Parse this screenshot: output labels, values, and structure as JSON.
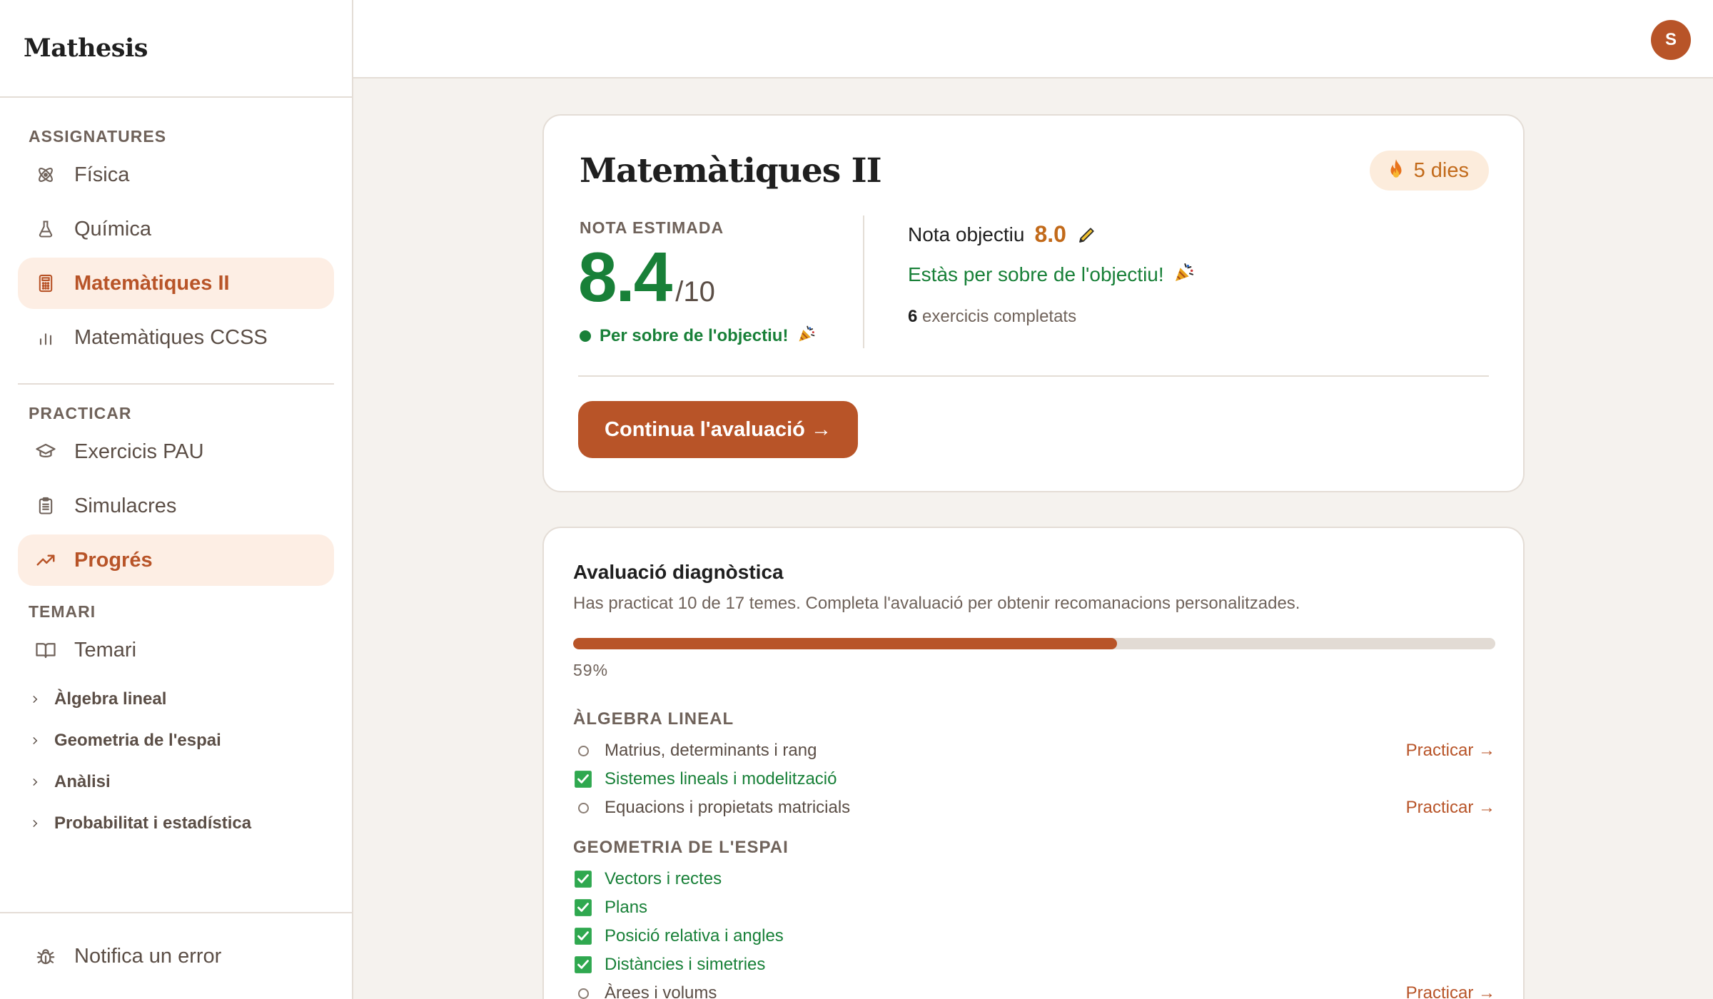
{
  "app": {
    "brand": "Mathesis"
  },
  "sidebar": {
    "sections": [
      {
        "heading": "ASSIGNATURES",
        "items": [
          {
            "label": "Física",
            "icon": "atom-icon",
            "active": false
          },
          {
            "label": "Química",
            "icon": "flask-icon",
            "active": false
          },
          {
            "label": "Matemàtiques II",
            "icon": "calculator-icon",
            "active": true
          },
          {
            "label": "Matemàtiques CCSS",
            "icon": "bar-chart-icon",
            "active": false
          }
        ]
      },
      {
        "heading": "PRACTICAR",
        "items": [
          {
            "label": "Exercicis PAU",
            "icon": "graduation-cap-icon",
            "active": false
          },
          {
            "label": "Simulacres",
            "icon": "clipboard-icon",
            "active": false
          },
          {
            "label": "Progrés",
            "icon": "trending-up-icon",
            "active": true
          }
        ]
      },
      {
        "heading": "TEMARI",
        "items": [
          {
            "label": "Temari",
            "icon": "book-icon",
            "active": false
          }
        ]
      }
    ],
    "tree": [
      "Àlgebra lineal",
      "Geometria de l'espai",
      "Anàlisi",
      "Probabilitat i estadística"
    ],
    "footer": {
      "label": "Notifica un error",
      "icon": "bug-icon"
    }
  },
  "topbar": {
    "avatar_initial": "S"
  },
  "summary": {
    "title": "Matemàtiques II",
    "streak": {
      "icon": "flame-icon",
      "label": "5 dies"
    },
    "estimated_label": "NOTA ESTIMADA",
    "estimated_value": "8.4",
    "estimated_scale": "/10",
    "estimated_status": "Per sobre de l'objectiu!",
    "goal_label": "Nota objectiu",
    "goal_value": "8.0",
    "goal_message": "Estàs per sobre de l'objectiu!",
    "exercises_count": "6",
    "exercises_label": " exercicis completats",
    "cta_label": "Continua l'avaluació →"
  },
  "diagnostic": {
    "title": "Avaluació diagnòstica",
    "description": "Has practicat 10 de 17 temes. Completa l'avaluació per obtenir recomanacions personalitzades.",
    "progress": 0.59,
    "progress_label": "59%",
    "practice_label": "Practicar →",
    "groups": [
      {
        "title": "ÀLGEBRA LINEAL",
        "topics": [
          {
            "name": "Matrius, determinants i rang",
            "done": false
          },
          {
            "name": "Sistemes lineals i modelització",
            "done": true
          },
          {
            "name": "Equacions i propietats matricials",
            "done": false
          }
        ]
      },
      {
        "title": "GEOMETRIA DE L'ESPAI",
        "topics": [
          {
            "name": "Vectors i rectes",
            "done": true
          },
          {
            "name": "Plans",
            "done": true
          },
          {
            "name": "Posició relativa i angles",
            "done": true
          },
          {
            "name": "Distàncies i simetries",
            "done": true
          },
          {
            "name": "Àrees i volums",
            "done": false
          }
        ]
      }
    ]
  },
  "colors": {
    "accent": "#b85428",
    "success": "#188038",
    "streak": "#c26a1a"
  }
}
